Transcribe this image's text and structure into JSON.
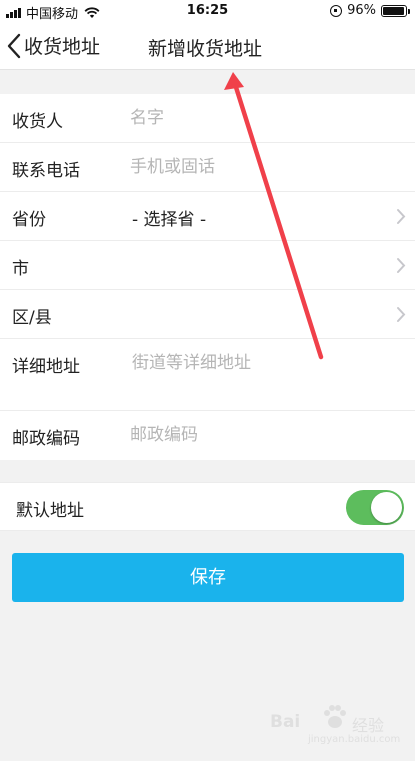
{
  "status_bar": {
    "carrier": "中国移动",
    "time": "16:25",
    "battery": "96%",
    "battery_level": 0.96
  },
  "nav": {
    "back_label": "收货地址",
    "title": "新增收货地址"
  },
  "form": {
    "receiver": {
      "label": "收货人",
      "placeholder": "名字"
    },
    "phone": {
      "label": "联系电话",
      "placeholder": "手机或固话"
    },
    "province": {
      "label": "省份",
      "value": "- 选择省 -"
    },
    "city": {
      "label": "市"
    },
    "district": {
      "label": "区/县"
    },
    "detail": {
      "label": "详细地址",
      "placeholder": "街道等详细地址"
    },
    "postcode": {
      "label": "邮政编码",
      "placeholder": "邮政编码"
    }
  },
  "default_address": {
    "label": "默认地址",
    "enabled": true
  },
  "save_label": "保存",
  "watermark": {
    "brand": "Bai",
    "cn": "经验",
    "url": "jingyan.baidu.com"
  },
  "colors": {
    "accent_button": "#1ab3ec",
    "toggle_on": "#5dbd5d",
    "annotation_arrow": "#f0404a",
    "background": "#f2f2f2"
  }
}
